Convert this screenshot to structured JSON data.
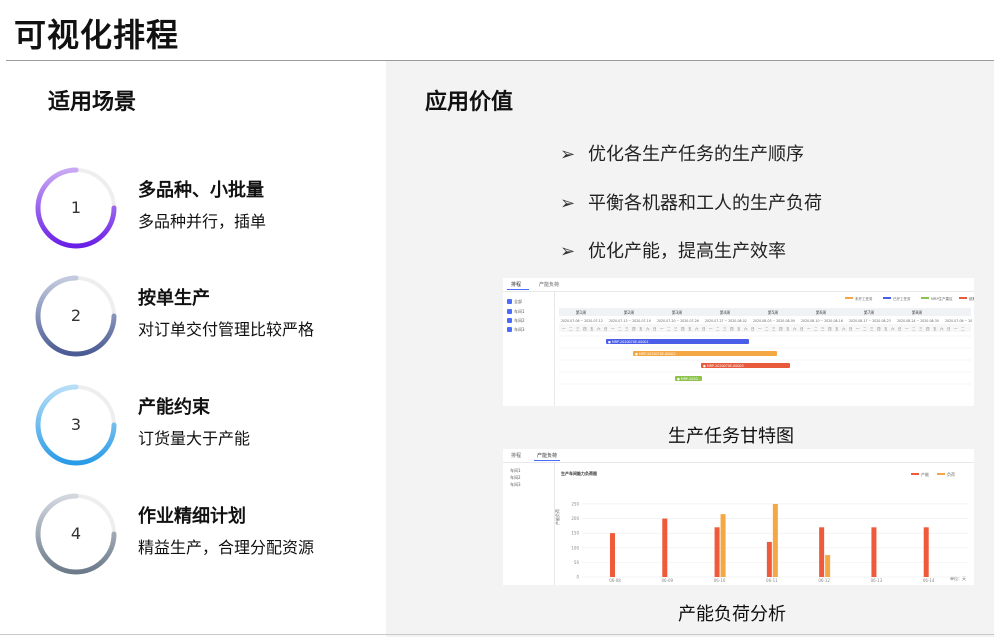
{
  "title": "可视化排程",
  "left": {
    "heading": "适用场景",
    "scenes": [
      {
        "num": "1",
        "title": "多品种、小批量",
        "desc": "多品种并行，插单",
        "ring_color": "#6a1fe6",
        "ring_color2": "#c9a8f5"
      },
      {
        "num": "2",
        "title": "按单生产",
        "desc": "对订单交付管理比较严格",
        "ring_color": "#4a5a94",
        "ring_color2": "#c4cbe0"
      },
      {
        "num": "3",
        "title": "产能约束",
        "desc": "订货量大于产能",
        "ring_color": "#2a9be6",
        "ring_color2": "#b7def7"
      },
      {
        "num": "4",
        "title": "作业精细计划",
        "desc": "精益生产，合理分配资源",
        "ring_color": "#6c7a8a",
        "ring_color2": "#d3d8de"
      }
    ]
  },
  "right": {
    "heading": "应用价值",
    "bullet_icon": "arrowhead-bullet-icon",
    "values": [
      "优化各生产任务的生产顺序",
      "平衡各机器和工人的生产负荷",
      "优化产能，提高生产效率"
    ]
  },
  "gantt": {
    "caption": "生产任务甘特图",
    "tabs": [
      "排程",
      "产能负荷"
    ],
    "checkboxes": [
      "全部",
      "车间1",
      "车间2",
      "车间3"
    ],
    "legend": [
      {
        "label": "未开工任务",
        "color": "#f4a742"
      },
      {
        "label": "已开工任务",
        "color": "#4a5ee8"
      },
      {
        "label": "MRP生产建议",
        "color": "#8bc34a"
      },
      {
        "label": "超期",
        "color": "#e85a3c"
      }
    ],
    "weeks": [
      "第1周",
      "第2周",
      "第3周",
      "第4周",
      "第5周",
      "第6周",
      "第7周",
      "第8周"
    ],
    "ranges": [
      "2020-07-06 ~ 2020-07-12",
      "2020-07-13 ~ 2020-07-19",
      "2020-07-20 ~ 2020-07-26",
      "2020-07-27 ~ 2020-08-02",
      "2020-08-03 ~ 2020-08-09",
      "2020-08-10 ~ 2020-08-16",
      "2020-08-17 ~ 2020-08-23",
      "2020-08-24 ~ 2020-08-30",
      "2020-07-06 ~ 20"
    ],
    "bars": [
      {
        "label": "● MRP-2020070E-00001",
        "color": "#4a5ee8"
      },
      {
        "label": "● MRP-2020070E-00002",
        "color": "#f4a742"
      },
      {
        "label": "● MRP-2020070E-00003",
        "color": "#e85a3c"
      },
      {
        "label": "● MRP-2020...",
        "color": "#8bc34a"
      }
    ]
  },
  "load": {
    "caption": "产能负荷分析",
    "tabs": [
      "排程",
      "产能负荷"
    ],
    "checkboxes": [
      "车间1",
      "车间2",
      "车间3"
    ],
    "chart_title": "生产车间能力负荷图",
    "ylabel": "产能负荷",
    "unit_label": "单位：天",
    "chart_data": {
      "type": "bar",
      "categories": [
        "06-08",
        "06-09",
        "06-10",
        "06-11",
        "06-12",
        "06-13",
        "06-14"
      ],
      "series": [
        {
          "name": "产能",
          "color": "#ee5a3a",
          "values": [
            150,
            200,
            170,
            120,
            170,
            170,
            170
          ]
        },
        {
          "name": "负荷",
          "color": "#f4a742",
          "values": [
            0,
            0,
            215,
            250,
            75,
            0,
            0
          ]
        }
      ],
      "yticks": [
        "0",
        "50",
        "100",
        "150",
        "200",
        "250"
      ],
      "ylim": [
        0,
        260
      ]
    }
  }
}
